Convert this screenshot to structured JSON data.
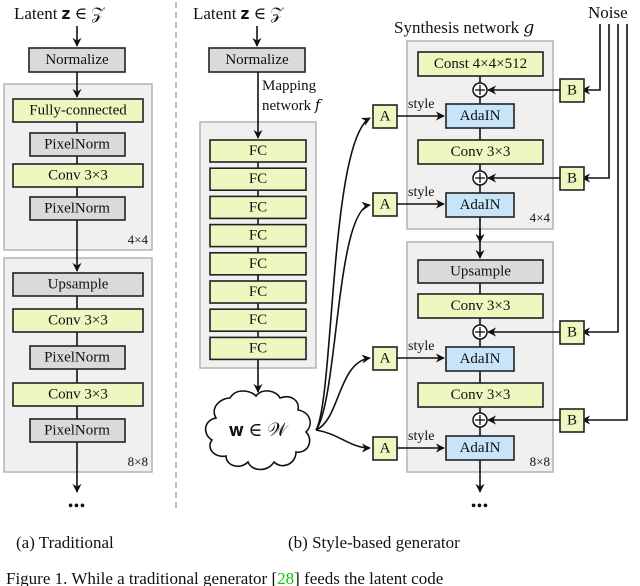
{
  "traditional": {
    "input_label": "Latent 𝐳 ∈ 𝒵",
    "normalize": "Normalize",
    "block1": {
      "layers": [
        "Fully-connected",
        "PixelNorm",
        "Conv 3×3",
        "PixelNorm"
      ],
      "resolution": "4×4"
    },
    "block2": {
      "layers": [
        "Upsample",
        "Conv 3×3",
        "PixelNorm",
        "Conv 3×3",
        "PixelNorm"
      ],
      "resolution": "8×8"
    },
    "continuation": "•••",
    "caption": "(a) Traditional"
  },
  "style_based": {
    "input_label": "Latent 𝐳 ∈ 𝒵",
    "normalize": "Normalize",
    "mapping_label_line1": "Mapping",
    "mapping_label_line2": "network 𝑓",
    "mapping_layers": [
      "FC",
      "FC",
      "FC",
      "FC",
      "FC",
      "FC",
      "FC",
      "FC"
    ],
    "w_label": "𝐰 ∈ 𝒲",
    "synthesis_title": "Synthesis network 𝑔",
    "noise_label": "Noise",
    "affine_label": "A",
    "noise_scale_label": "B",
    "style_label": "style",
    "adain_label": "AdaIN",
    "block1": {
      "const": "Const 4×4×512",
      "conv": "Conv 3×3",
      "resolution": "4×4"
    },
    "block2": {
      "upsample": "Upsample",
      "conv1": "Conv 3×3",
      "conv2": "Conv 3×3",
      "resolution": "8×8"
    },
    "continuation": "•••",
    "caption": "(b) Style-based generator"
  },
  "figure_caption": {
    "prefix": "Figure 1. While a traditional generator [",
    "citation": "28",
    "suffix": "] feeds the latent code",
    "citation_color": "#00cc00"
  },
  "colors": {
    "conv_fill": "#ecf8c0",
    "norm_fill": "#dadada",
    "adain_fill": "#c8e4f8",
    "block_bg": "#f0f0f0"
  }
}
